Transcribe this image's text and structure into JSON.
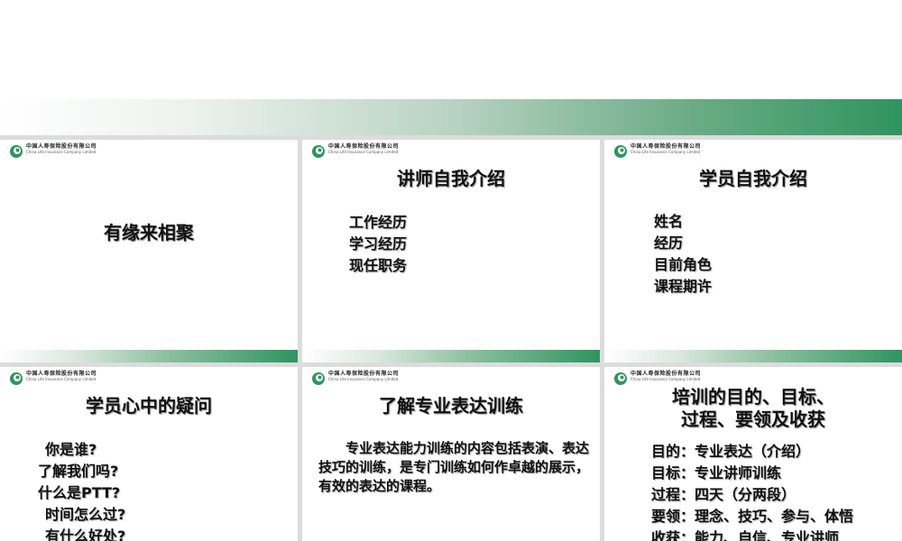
{
  "logo": {
    "company_cn": "中国人寿保险股份有限公司",
    "company_en": "China Life Insurance Company Limited"
  },
  "colors": {
    "accent": "#2f9460",
    "band_light": "#ffffff"
  },
  "slides": [
    {
      "title": "有缘来相聚",
      "items": []
    },
    {
      "title": "讲师自我介绍",
      "items": [
        "工作经历",
        "学习经历",
        "现任职务"
      ]
    },
    {
      "title": "学员自我介绍",
      "items": [
        "姓名",
        "经历",
        "目前角色",
        "课程期许"
      ]
    },
    {
      "title": "学员心中的疑问",
      "items": [
        "你是谁?",
        "了解我们吗?",
        "什么是PTT?",
        "时间怎么过?",
        "有什么好处?"
      ]
    },
    {
      "title": "了解专业表达训练",
      "paragraph": "专业表达能力训练的内容包括表演、表达技巧的训练，是专门训练如何作卓越的展示，有效的表达的课程。"
    },
    {
      "title_lines": [
        "培训的目的、目标、",
        "过程、要领及收获"
      ],
      "items": [
        "目的：专业表达（介绍）",
        "目标：专业讲师训练",
        "过程：四天（分两段）",
        "要领：理念、技巧、参与、体悟",
        "收获：能力、自信、专业讲师"
      ]
    }
  ]
}
